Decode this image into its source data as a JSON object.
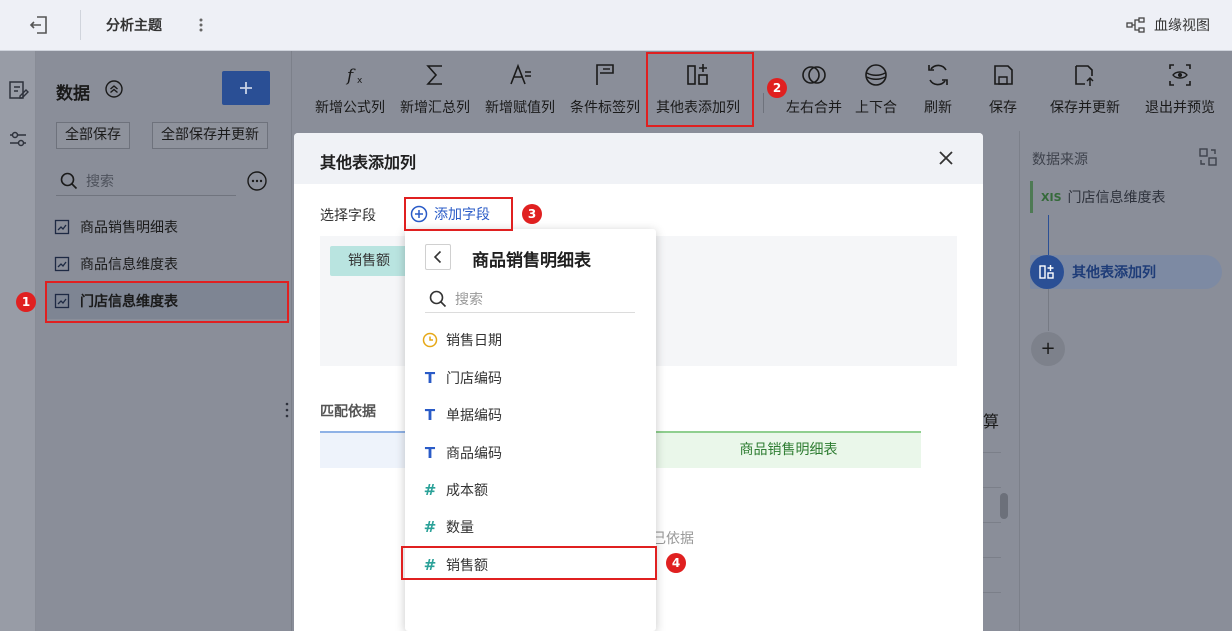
{
  "topbar": {
    "title": "分析主题",
    "lineage_label": "血缘视图"
  },
  "left_panel": {
    "title": "数据",
    "save_all": "全部保存",
    "save_all_update": "全部保存并更新",
    "search_placeholder": "搜索",
    "items": [
      {
        "label": "商品销售明细表",
        "selected": false
      },
      {
        "label": "商品信息维度表",
        "selected": false
      },
      {
        "label": "门店信息维度表",
        "selected": true
      }
    ]
  },
  "toolbar": {
    "tools": [
      {
        "label": "新增公式列",
        "icon": "fx-icon"
      },
      {
        "label": "新增汇总列",
        "icon": "sigma-icon"
      },
      {
        "label": "新增赋值列",
        "icon": "assign-icon"
      },
      {
        "label": "条件标签列",
        "icon": "flag-icon"
      },
      {
        "label": "其他表添加列",
        "icon": "table-add-icon"
      },
      {
        "label": "左右合并",
        "icon": "merge-horizontal-icon"
      },
      {
        "label": "上下合",
        "icon": "merge-vertical-icon"
      },
      {
        "label": "刷新",
        "icon": "refresh-icon"
      },
      {
        "label": "保存",
        "icon": "save-icon"
      },
      {
        "label": "保存并更新",
        "icon": "save-update-icon"
      },
      {
        "label": "退出并预览",
        "icon": "preview-icon"
      }
    ]
  },
  "workspace": {
    "partial_text": "算"
  },
  "right_panel": {
    "title": "数据来源",
    "source_badge": "XIS",
    "source_table": "门店信息维度表",
    "step_label": "其他表添加列",
    "add_label": "+"
  },
  "modal": {
    "title": "其他表添加列",
    "select_field_label": "选择字段",
    "add_field_label": "添加字段",
    "selected_chip": "销售额",
    "match_label": "匹配依据",
    "match_right_header": "商品销售明细表",
    "match_hint": "己依据"
  },
  "dropdown": {
    "title": "商品销售明细表",
    "search_placeholder": "搜索",
    "fields": [
      {
        "label": "销售日期",
        "type": "date",
        "color": "#e6a817"
      },
      {
        "label": "门店编码",
        "type": "text",
        "color": "#2a5bc7"
      },
      {
        "label": "单据编码",
        "type": "text",
        "color": "#2a5bc7"
      },
      {
        "label": "商品编码",
        "type": "text",
        "color": "#2a5bc7"
      },
      {
        "label": "成本额",
        "type": "number",
        "color": "#2aa198"
      },
      {
        "label": "数量",
        "type": "number",
        "color": "#2aa198"
      },
      {
        "label": "销售额",
        "type": "number",
        "color": "#2aa198"
      }
    ]
  },
  "annotations": {
    "steps": [
      "1",
      "2",
      "3",
      "4"
    ],
    "color": "#e02020"
  },
  "colors": {
    "primary": "#2a4f95",
    "link": "#2a5bc7",
    "overlay": "#8a8e99"
  }
}
